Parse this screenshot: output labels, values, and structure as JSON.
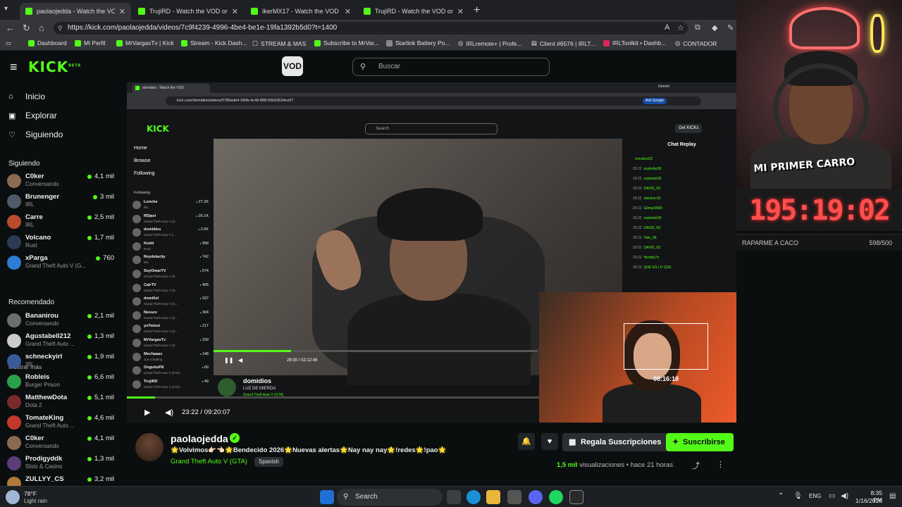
{
  "browser": {
    "tabs": [
      {
        "title": "paolaojedda - Watch the VOD on Kick",
        "active": true
      },
      {
        "title": "TrujiRD - Watch the VOD on Kick",
        "active": false
      },
      {
        "title": "IkerMX17 - Watch the VOD on Kick",
        "active": false
      },
      {
        "title": "TrujiRD - Watch the VOD on Kick",
        "active": false
      }
    ],
    "url": "https://kick.com/paolaojedda/videos/7c9f4239-4996-4be4-be1e-19fa1392b5d0?t=1400",
    "bookmarks": [
      "Dashboard",
      "Mi Perfil",
      "MrVargasTv | Kick",
      "Stream - Kick Dash...",
      "STREAM & MAS",
      "Subscribe to MrVar...",
      "Starlink Battery Po...",
      "IRLremote+ | Profe...",
      "Client #6576 | IRLT...",
      "IRLToolkit • Dashb...",
      "CONTADOR"
    ]
  },
  "header": {
    "logo": "KICK",
    "logo_sup": "BETA",
    "vod_icon": "VOD",
    "search_placeholder": "Buscar"
  },
  "sidebar": {
    "nav": [
      {
        "label": "Inicio",
        "icon": "home-icon"
      },
      {
        "label": "Explorar",
        "icon": "compass-icon"
      },
      {
        "label": "Siguiendo",
        "icon": "heart-icon"
      }
    ],
    "following_title": "Siguiendo",
    "following": [
      {
        "name": "C0ker",
        "sub": "Conversando",
        "viewers": "4,1 mil",
        "color": "#8a6a52"
      },
      {
        "name": "Brunenger",
        "sub": "IRL",
        "viewers": "3 mil",
        "color": "#4f5a68"
      },
      {
        "name": "Carre",
        "sub": "IRL",
        "viewers": "2,5 mil",
        "color": "#b84b2c"
      },
      {
        "name": "Volcano",
        "sub": "Rust",
        "viewers": "1,7 mil",
        "color": "#2d3a55"
      },
      {
        "name": "xParga",
        "sub": "Grand Theft Auto V (G...",
        "viewers": "760",
        "color": "#2d7dd2"
      }
    ],
    "show_more": "Mostrar más",
    "recommended_title": "Recomendado",
    "recommended": [
      {
        "name": "Bananirou",
        "sub": "Conversando",
        "viewers": "2,1 mil",
        "color": "#6e6e6e"
      },
      {
        "name": "Agustabell212",
        "sub": "Grand Theft Auto ...",
        "viewers": "1,3 mil",
        "color": "#cccccc"
      },
      {
        "name": "schneckyirl",
        "sub": "IRL",
        "viewers": "1,9 mil",
        "color": "#3a5b9a"
      },
      {
        "name": "Robleis",
        "sub": "Burger Prison",
        "viewers": "6,6 mil",
        "color": "#2aa04a"
      },
      {
        "name": "MatthewDota",
        "sub": "Dota 2",
        "viewers": "5,1 mil",
        "color": "#7a2a2a"
      },
      {
        "name": "TomateKing",
        "sub": "Grand Theft Auto ...",
        "viewers": "4,6 mil",
        "color": "#c0392b"
      },
      {
        "name": "C0ker",
        "sub": "Conversando",
        "viewers": "4,1 mil",
        "color": "#8a6a52"
      },
      {
        "name": "Prodigyddk",
        "sub": "Slots & Casino",
        "viewers": "1,3 mil",
        "color": "#5b3d7a"
      },
      {
        "name": "ZULLYY_CS",
        "sub": "",
        "viewers": "3,2 mil",
        "color": "#b07a3a"
      }
    ]
  },
  "inner_page": {
    "tab_title": "domidios - Watch the VOD",
    "gemini": "Gemini",
    "url": "kick.com/domidios/videos/5789edb4-284b-4c48-8f8f-55b53634ce97",
    "ask": "Ask Google",
    "logo": "KICK",
    "search": "Search",
    "get_kicks": "Get KICKs",
    "nav": [
      "Home",
      "Browse",
      "Following"
    ],
    "following_title": "Following",
    "channels": [
      {
        "name": "Lonche",
        "sub": "IRL",
        "viewers": "27.2K"
      },
      {
        "name": "RDjavi",
        "sub": "Grand Theft Auto V (G...",
        "viewers": "26.1K"
      },
      {
        "name": "domidios",
        "sub": "Grand Theft Auto V (...",
        "viewers": "2.6K"
      },
      {
        "name": "Kodd",
        "sub": "Rust",
        "viewers": "958"
      },
      {
        "name": "Reydelacity",
        "sub": "IRL",
        "viewers": "742"
      },
      {
        "name": "SoyOmarTV",
        "sub": "Grand Theft Auto V (G...",
        "viewers": "574"
      },
      {
        "name": "CairTV",
        "sub": "Grand Theft Auto V (G...",
        "viewers": "405"
      },
      {
        "name": "domiliol",
        "sub": "Grand Theft Auto V (G...",
        "viewers": "337"
      },
      {
        "name": "Nesszv",
        "sub": "Grand Theft Auto V (G...",
        "viewers": "304"
      },
      {
        "name": "yoTwisst",
        "sub": "Grand Theft Auto V (G...",
        "viewers": "217"
      },
      {
        "name": "MrVargasTv",
        "sub": "Grand Theft Auto V (G...",
        "viewers": "159"
      },
      {
        "name": "Mechaaax",
        "sub": "Just Chatting",
        "viewers": "148"
      },
      {
        "name": "OnguitoFN",
        "sub": "Grand Theft Auto V (GTA)",
        "viewers": "69"
      },
      {
        "name": "TrujiRD",
        "sub": "Grand Theft Auto V (GTA)",
        "viewers": "49"
      }
    ],
    "time": "29:30 / 02:12:49",
    "streamer": "domidios",
    "stream_title": "LUZ DE MIERDA",
    "category": "Grand Theft Auto V (GTA)",
    "chat_title": "Chat Replay",
    "chat": [
      {
        "t": "",
        "u": "romulord12"
      },
      {
        "t": "29:22",
        "u": "soybebe28:"
      },
      {
        "t": "29:22",
        "u": "soybebe28:"
      },
      {
        "t": "29:22",
        "u": "DAVID_93:"
      },
      {
        "t": "29:22",
        "u": "stanlyxv15:"
      },
      {
        "t": "29:22",
        "u": "Gilmar0680:"
      },
      {
        "t": "29:22",
        "u": "soybebe28:"
      },
      {
        "t": "29:22",
        "u": "DAVID_93:"
      },
      {
        "t": "29:22",
        "u": "Tate_28:"
      },
      {
        "t": "29:22",
        "u": "DAVID_93:"
      },
      {
        "t": "29:22",
        "u": "Hendry7x:"
      },
      {
        "t": "29:23",
        "u": "QUE ES LO QUE"
      }
    ]
  },
  "cam": {
    "badge": "MI PRIMER CARRO",
    "timer": "195:19:02",
    "goal_label": "RAPARME A CACO",
    "goal_count": "598/500"
  },
  "cam2": {
    "time": "08:16:18"
  },
  "player": {
    "time": "23:22 / 09:20:07"
  },
  "channel_info": {
    "name": "paolaojedda",
    "title": "🌟Volvimos👉🏻👈🏻🌟Bendecido 2026🌟Nuevas alertas🌟Nay nay nay🌟!redes🌟!pao🌟",
    "category": "Grand Theft Auto V (GTA)",
    "language": "Spanish",
    "gift_label": "Regala Suscripciones",
    "subscribe_label": "Suscribirse",
    "views_count": "1,5 mil",
    "views_word": "visualizaciones",
    "ago": "hace 21 horas"
  },
  "taskbar": {
    "temp": "78°F",
    "weather": "Light rain",
    "search": "Search",
    "lang": "ENG",
    "time": "8:35 PM",
    "date": "1/16/2026"
  },
  "colors": {
    "kick_green": "#53fc18",
    "timer_red": "#ff4f4f"
  }
}
